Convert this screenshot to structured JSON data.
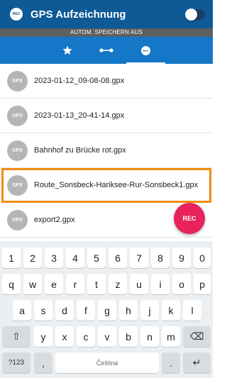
{
  "app": {
    "title": "GPS Aufzeichnung",
    "logo_text": "REC",
    "toggle_on": false,
    "colors": {
      "appbar": "#0d5a96",
      "tabs": "#1477c7",
      "fab": "#e8225a",
      "highlight": "#f38b10"
    }
  },
  "autosave": {
    "label": "AUTOM. SPEICHERN AUS"
  },
  "tabs": [
    {
      "icon": "star-icon",
      "selected": false
    },
    {
      "icon": "route-icon",
      "selected": false
    },
    {
      "icon": "rec-icon",
      "label": "REC",
      "selected": true
    }
  ],
  "files": [
    {
      "badge": "GPX",
      "name": "2023-01-12_09-08-08.gpx"
    },
    {
      "badge": "GPX",
      "name": "2023-01-13_20-41-14.gpx"
    },
    {
      "badge": "GPX",
      "name": "Bahnhof zu Brücke rot.gpx"
    },
    {
      "badge": "GPX",
      "name": "Route_Sonsbeck-Hariksee-Rur-Sonsbeck1.gpx",
      "highlighted": true
    },
    {
      "badge": "GPX",
      "name": "export2.gpx"
    }
  ],
  "fab": {
    "label": "REC"
  },
  "keyboard": {
    "row1": [
      "1",
      "2",
      "3",
      "4",
      "5",
      "6",
      "7",
      "8",
      "9",
      "0"
    ],
    "row2": [
      "q",
      "w",
      "e",
      "r",
      "t",
      "z",
      "u",
      "i",
      "o",
      "p"
    ],
    "row3": [
      "a",
      "s",
      "d",
      "f",
      "g",
      "h",
      "j",
      "k",
      "l"
    ],
    "row4": [
      "y",
      "x",
      "c",
      "v",
      "b",
      "n",
      "m"
    ],
    "symbols_label": "?123",
    "comma": ",",
    "space_label": "Čeština",
    "period": ".",
    "shift_glyph": "⇧",
    "backspace_glyph": "⌫",
    "enter_glyph": "↵"
  }
}
